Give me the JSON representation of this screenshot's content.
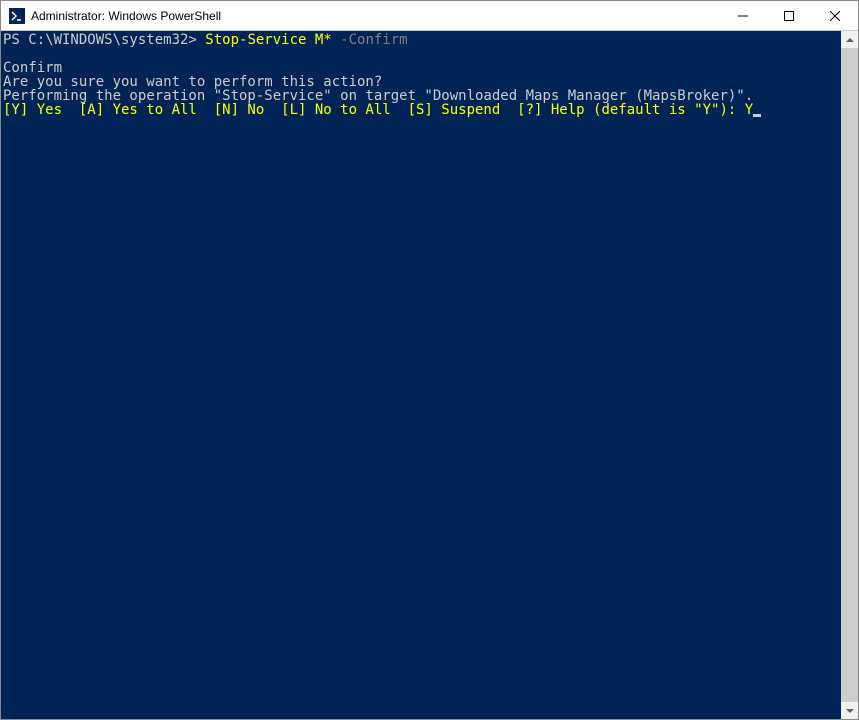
{
  "window": {
    "title": "Administrator: Windows PowerShell"
  },
  "terminal": {
    "prompt": "PS C:\\WINDOWS\\system32> ",
    "command": "Stop-Service M*",
    "param": " -Confirm",
    "line_blank": "",
    "line_confirm": "Confirm",
    "line_question": "Are you sure you want to perform this action?",
    "line_operation": "Performing the operation \"Stop-Service\" on target \"Downloaded Maps Manager (MapsBroker)\".",
    "options": "[Y] Yes  [A] Yes to All  [N] No  [L] No to All  [S] Suspend  [?] Help (default is \"Y\"): ",
    "input_response": "Y"
  }
}
